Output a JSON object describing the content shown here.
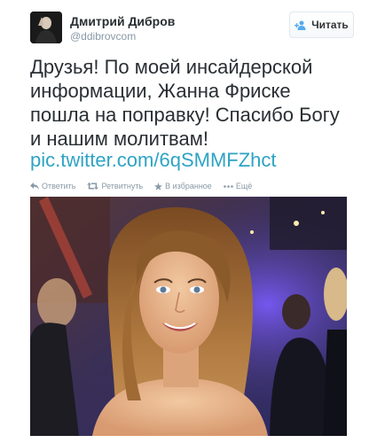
{
  "user": {
    "name": "Дмитрий Дибров",
    "handle": "@ddibrovcom"
  },
  "follow": {
    "label": "Читать",
    "icon": "follow-person-plus-icon"
  },
  "tweet": {
    "lines": [
      "Друзья! По моей инсайдерской",
      "информации, Жанна Фриске",
      "пошла на поправку! Спасибо Богу",
      "и нашим молитвам!"
    ],
    "link": "pic.twitter.com/6qSMMFZhct"
  },
  "actions": {
    "reply": {
      "label": "Ответить",
      "icon": "reply-icon"
    },
    "retweet": {
      "label": "Ретвитнуть",
      "icon": "retweet-icon"
    },
    "favorite": {
      "label": "В избранное",
      "icon": "star-icon"
    },
    "more": {
      "label": "Ещё",
      "icon": "more-dots-icon"
    }
  },
  "colors": {
    "link": "#2fa3c4",
    "muted": "#8899a6",
    "text": "#292f33"
  }
}
